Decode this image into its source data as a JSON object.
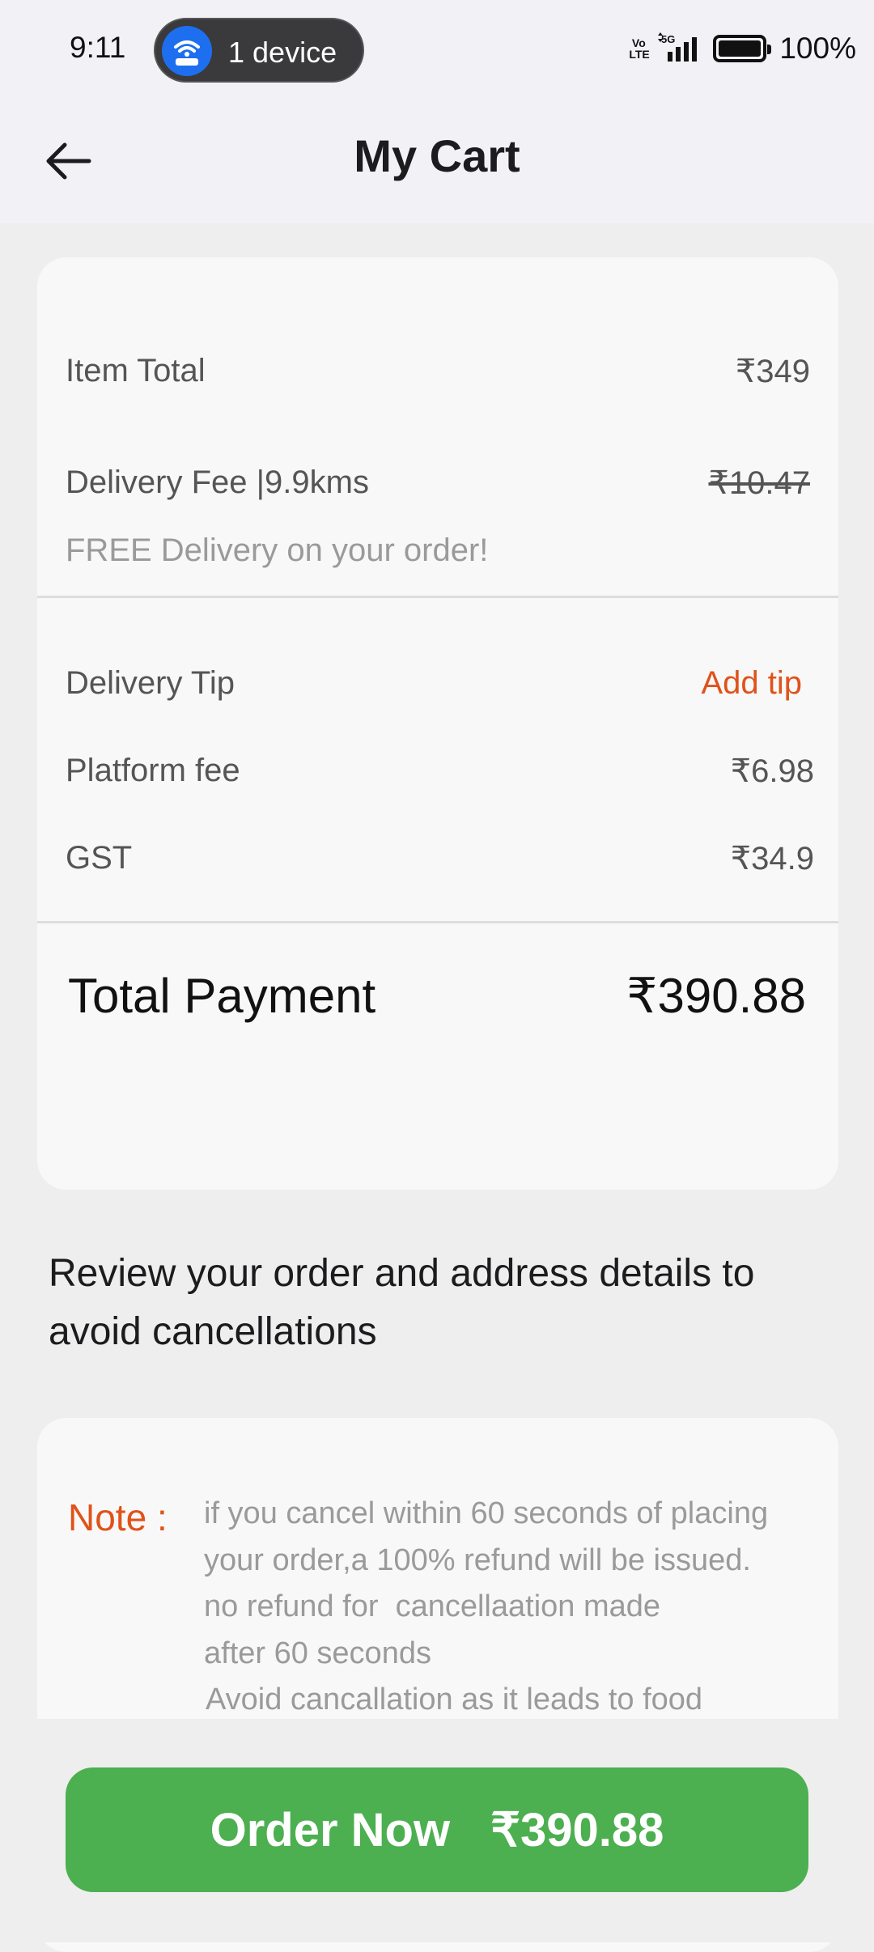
{
  "status_bar": {
    "time": "9:11",
    "hotspot_label": "1 device",
    "network": "5G",
    "volte": "Vo LTE",
    "battery": "100%"
  },
  "header": {
    "title": "My Cart",
    "back_icon": "arrow-left-icon"
  },
  "bill": {
    "item_total_label": "Item Total",
    "item_total_value": "₹349",
    "delivery_fee_label": "Delivery Fee |9.9kms",
    "delivery_fee_value": "₹10.47",
    "free_delivery_text": "FREE Delivery on your order!",
    "delivery_tip_label": "Delivery Tip",
    "add_tip_label": "Add tip",
    "platform_fee_label": "Platform fee",
    "platform_fee_value": "₹6.98",
    "gst_label": "GST",
    "gst_value": "₹34.9",
    "total_label": "Total Payment",
    "total_value": "₹390.88"
  },
  "review_text": "Review your order and address details to avoid cancellations",
  "note": {
    "label": "Note :",
    "lines": [
      "if you cancel within 60 seconds of placing",
      "your order,a 100% refund will be issued.",
      "no refund for  cancellaation made",
      "after 60 seconds",
      "Avoid cancallation as it leads to food"
    ]
  },
  "order_button": {
    "label": "Order Now",
    "amount": "₹390.88"
  },
  "colors": {
    "accent_orange": "#e0521a",
    "order_green": "#4caf50",
    "hotspot_blue": "#1e6ff0"
  }
}
